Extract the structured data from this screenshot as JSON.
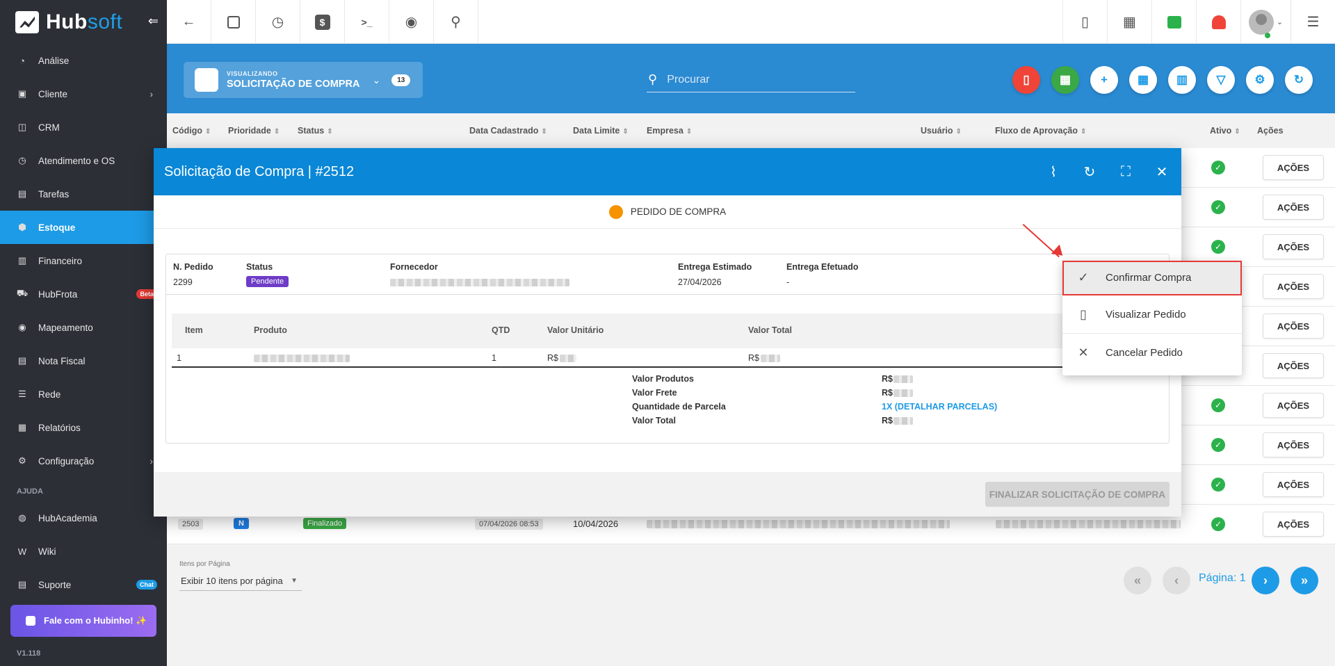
{
  "brand": {
    "name_a": "Hub",
    "name_b": "soft",
    "version": "V1.118"
  },
  "sidebar": {
    "items": [
      {
        "label": "Análise",
        "icon": "chart-icon"
      },
      {
        "label": "Cliente",
        "icon": "contact-icon"
      },
      {
        "label": "CRM",
        "icon": "crm-icon"
      },
      {
        "label": "Atendimento e OS",
        "icon": "clock-icon"
      },
      {
        "label": "Tarefas",
        "icon": "tasks-icon"
      },
      {
        "label": "Estoque",
        "icon": "box-icon"
      },
      {
        "label": "Financeiro",
        "icon": "money-icon"
      },
      {
        "label": "HubFrota",
        "icon": "car-icon",
        "badge": "Beta"
      },
      {
        "label": "Mapeamento",
        "icon": "pin-icon"
      },
      {
        "label": "Nota Fiscal",
        "icon": "invoice-icon"
      },
      {
        "label": "Rede",
        "icon": "network-icon"
      },
      {
        "label": "Relatórios",
        "icon": "report-icon"
      },
      {
        "label": "Configuração",
        "icon": "gear-icon"
      }
    ],
    "help_section": "AJUDA",
    "help_items": [
      {
        "label": "HubAcademia",
        "icon": "academy-icon"
      },
      {
        "label": "Wiki",
        "icon": "wiki-icon"
      },
      {
        "label": "Suporte",
        "icon": "support-icon",
        "badge": "Chat"
      }
    ],
    "hubinho": "Fale com o Hubinho! ✨"
  },
  "header": {
    "viewing_label": "VISUALIZANDO",
    "viewing_title": "SOLICITAÇÃO DE COMPRA",
    "count": "13",
    "search_placeholder": "Procurar"
  },
  "table": {
    "columns": [
      "Código",
      "Prioridade",
      "Status",
      "Data Cadastrado",
      "Data Limite",
      "Empresa",
      "Usuário",
      "Fluxo de Aprovação",
      "Ativo",
      "Ações"
    ],
    "action_label": "AÇÕES",
    "last_row": {
      "code": "2503",
      "priority": "N",
      "status": "Finalizado",
      "created": "07/04/2026 08:53",
      "limit": "10/04/2026"
    }
  },
  "pagination": {
    "ipp_label": "Itens por Página",
    "ipp_value": "Exibir 10 itens por página",
    "page_label": "Página: 1"
  },
  "modal": {
    "title": "Solicitação de Compra | #2512",
    "stage": "PEDIDO DE COMPRA",
    "order": {
      "n_pedido_label": "N. Pedido",
      "n_pedido": "2299",
      "status_label": "Status",
      "status": "Pendente",
      "fornecedor_label": "Fornecedor",
      "entrega_estimado_label": "Entrega Estimado",
      "entrega_estimado": "27/04/2026",
      "entrega_efetuado_label": "Entrega Efetuado",
      "entrega_efetuado": "-"
    },
    "items_columns": [
      "Item",
      "Produto",
      "QTD",
      "Valor Unitário",
      "Valor Total"
    ],
    "item": {
      "item": "1",
      "qtd": "1",
      "currency_unit": "R$",
      "currency_total": "R$"
    },
    "totals": {
      "valor_produtos_label": "Valor Produtos",
      "valor_produtos": "R$",
      "valor_frete_label": "Valor Frete",
      "valor_frete": "R$",
      "parcelas_label": "Quantidade de Parcela",
      "parcelas": "1X (DETALHAR PARCELAS)",
      "valor_total_label": "Valor Total",
      "valor_total": "R$"
    },
    "finalize_label": "FINALIZAR SOLICITAÇÃO DE COMPRA"
  },
  "dropdown": {
    "items": [
      {
        "label": "Confirmar Compra",
        "icon": "check-icon"
      },
      {
        "label": "Visualizar Pedido",
        "icon": "pdf-icon"
      },
      {
        "label": "Cancelar Pedido",
        "icon": "close-icon"
      }
    ]
  }
}
